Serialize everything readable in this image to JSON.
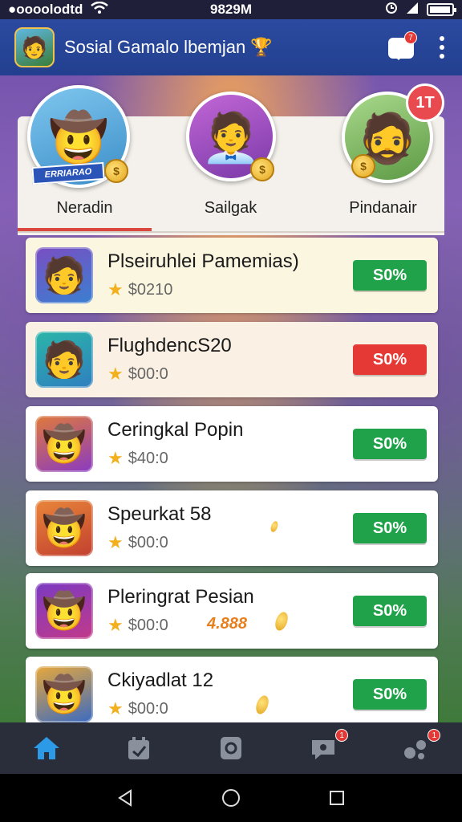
{
  "status_bar": {
    "carrier": "●oooolodtd",
    "time": "9829M"
  },
  "app_bar": {
    "title": "Sosial Gamalo lbemjan",
    "notification_count": "7"
  },
  "leaderboard": {
    "featured": [
      {
        "ribbon": "ERRIARAO"
      },
      {},
      {}
    ],
    "rank_badge": "1T",
    "tabs": [
      {
        "label": "Neradin",
        "active": true
      },
      {
        "label": "Sailgak",
        "active": false
      },
      {
        "label": "Pindanair",
        "active": false
      }
    ]
  },
  "rows": [
    {
      "name": "Plseiruhlei Pamemias)",
      "price": "$0210",
      "button": "S0%",
      "button_color": "#1fa24a",
      "bg": "#fbf6df"
    },
    {
      "name": "FlughdencS20",
      "price": "$00:0",
      "button": "S0%",
      "button_color": "#e53935",
      "bg": "#fbf0e4"
    },
    {
      "name": "Ceringkal Popin",
      "price": "$40:0",
      "button": "S0%",
      "button_color": "#1fa24a",
      "bg": "#ffffff"
    },
    {
      "name": "Speurkat 58",
      "price": "$00:0",
      "button": "S0%",
      "button_color": "#1fa24a",
      "bg": "#ffffff"
    },
    {
      "name": "Pleringrat Pesian",
      "price": "$00:0",
      "button": "S0%",
      "button_color": "#1fa24a",
      "bg": "#ffffff",
      "bonus": "4.888"
    },
    {
      "name": "Ckiyadlat 12",
      "price": "$00:0",
      "button": "S0%",
      "button_color": "#1fa24a",
      "bg": "#ffffff"
    }
  ],
  "bottom_nav": {
    "items": [
      {
        "icon": "home-icon",
        "active": true
      },
      {
        "icon": "calendar-icon",
        "active": false
      },
      {
        "icon": "chat-icon",
        "active": false
      },
      {
        "icon": "messages-icon",
        "active": false,
        "badge": "1"
      },
      {
        "icon": "friends-icon",
        "active": false,
        "badge": "1"
      }
    ]
  }
}
